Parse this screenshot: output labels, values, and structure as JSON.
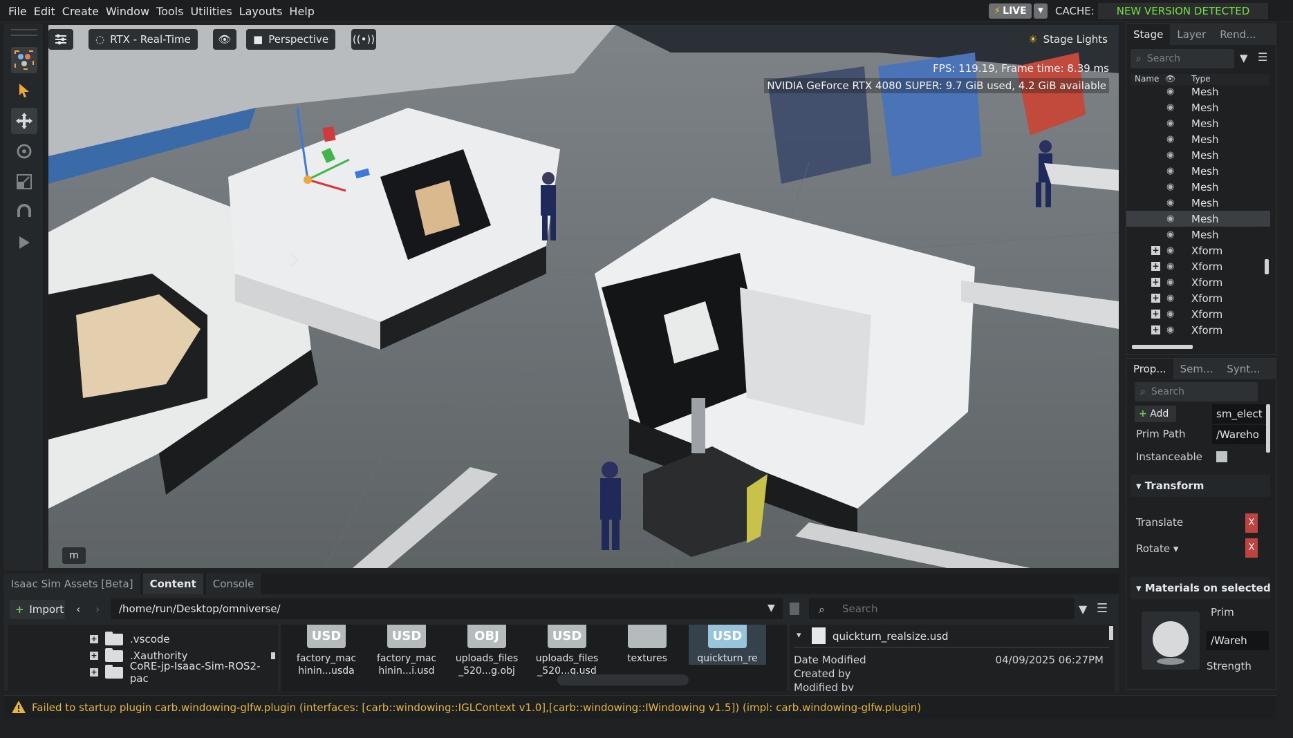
{
  "menu": [
    "File",
    "Edit",
    "Create",
    "Window",
    "Tools",
    "Utilities",
    "Layouts",
    "Help"
  ],
  "topbar": {
    "live": "LIVE",
    "cache_label": "CACHE:",
    "new_version": "NEW VERSION DETECTED"
  },
  "viewport": {
    "render_mode": "RTX - Real-Time",
    "camera": "Perspective",
    "stage_lights": "Stage Lights",
    "fps": "FPS: 119.19, Frame time: 8.39 ms",
    "gpu": "NVIDIA GeForce RTX 4080 SUPER: 9.7 GiB used, 4.2 GiB available",
    "nav_badge": "m"
  },
  "stage": {
    "tabs": [
      "Stage",
      "Layer",
      "Rend..."
    ],
    "search_placeholder": "Search",
    "col_name": "Name",
    "col_type": "Type",
    "rows": [
      {
        "type": "Mesh"
      },
      {
        "type": "Mesh"
      },
      {
        "type": "Mesh"
      },
      {
        "type": "Mesh"
      },
      {
        "type": "Mesh"
      },
      {
        "type": "Mesh"
      },
      {
        "type": "Mesh"
      },
      {
        "type": "Mesh"
      },
      {
        "type": "Mesh"
      },
      {
        "type": "Mesh"
      },
      {
        "type": "Xform"
      },
      {
        "type": "Xform"
      },
      {
        "type": "Xform"
      },
      {
        "type": "Xform"
      },
      {
        "type": "Xform"
      },
      {
        "type": "Xform"
      }
    ]
  },
  "properties": {
    "tabs": [
      "Prop...",
      "Sem...",
      "Synt..."
    ],
    "search_placeholder": "Search",
    "add_label": "Add",
    "add_value": "sm_elect",
    "prim_path_label": "Prim Path",
    "prim_path_value": "/Wareho",
    "instanceable_label": "Instanceable",
    "transform_label": "Transform",
    "translate_label": "Translate",
    "rotate_label": "Rotate",
    "x_label": "X",
    "materials_label": "Materials on selected r",
    "prim_label": "Prim",
    "prim_value": "/Wareh",
    "strength_label": "Strength"
  },
  "bottom": {
    "tabs": [
      "Isaac Sim Assets [Beta]",
      "Content",
      "Console"
    ],
    "import_label": "Import",
    "path": "/home/run/Desktop/omniverse/",
    "search_placeholder": "Search",
    "tree": [
      ".vscode",
      ".Xauthority",
      "CoRE-jp-Isaac-Sim-ROS2-pac"
    ],
    "files": [
      {
        "badge": "USD",
        "name1": "factory_mac",
        "name2": "hinin...usda"
      },
      {
        "badge": "USD",
        "name1": "factory_mac",
        "name2": "hinin...i.usd"
      },
      {
        "badge": "OBJ",
        "name1": "uploads_files",
        "name2": "_520...g.obj"
      },
      {
        "badge": "USD",
        "name1": "uploads_files",
        "name2": "_520...g.usd"
      },
      {
        "badge": "",
        "name1": "textures",
        "name2": ""
      },
      {
        "badge": "USD",
        "name1": "quickturn_re",
        "name2": ""
      }
    ],
    "detail_file": "quickturn_realsize.usd",
    "date_modified_label": "Date Modified",
    "date_modified_value": "04/09/2025 06:27PM",
    "created_by_label": "Created by",
    "modified_by_label": "Modified by"
  },
  "status": "Failed to startup plugin carb.windowing-glfw.plugin (interfaces: [carb::windowing::IGLContext v1.0],[carb::windowing::IWindowing v1.5]) (impl: carb.windowing-glfw.plugin)",
  "colors": {
    "accent_green": "#76e33f",
    "warning": "#e5b63d",
    "x_red": "#c0433f"
  }
}
